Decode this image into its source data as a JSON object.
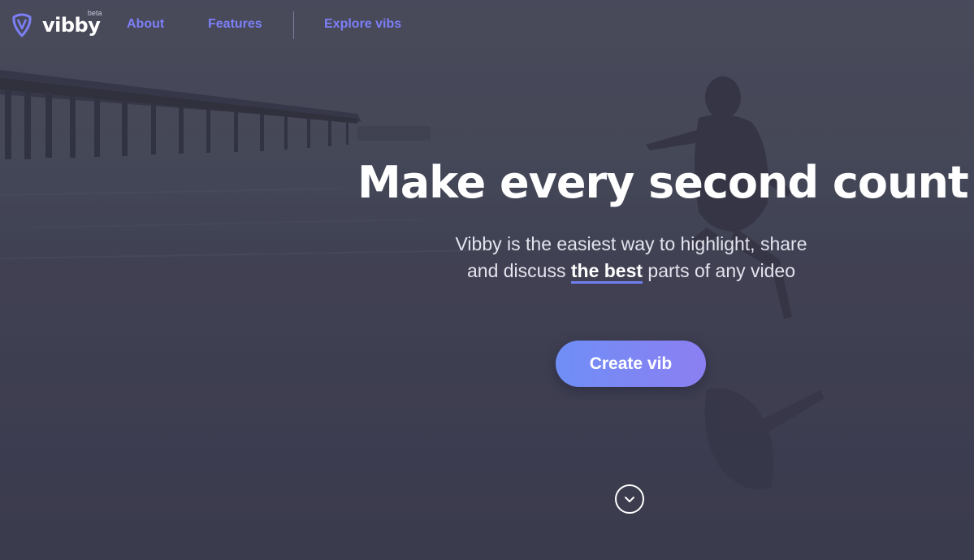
{
  "brand": {
    "name": "vibby",
    "badge": "beta",
    "logo_icon": "shield-v-icon",
    "logo_color": "#7d7ff7"
  },
  "nav": {
    "links": [
      {
        "label": "About"
      },
      {
        "label": "Features"
      },
      {
        "label": "Explore vibs"
      }
    ],
    "link_color": "#7d7ff7"
  },
  "hero": {
    "title": "Make every second count",
    "subtitle_line1": "Vibby is the easiest way to highlight, share",
    "subtitle_pre": "and discuss ",
    "subtitle_strong": "the best",
    "subtitle_post": " parts of any video",
    "cta_label": "Create vib",
    "cta_gradient": [
      "#6f8ef6",
      "#8c7ff2"
    ],
    "scroll_icon": "chevron-down-icon"
  }
}
